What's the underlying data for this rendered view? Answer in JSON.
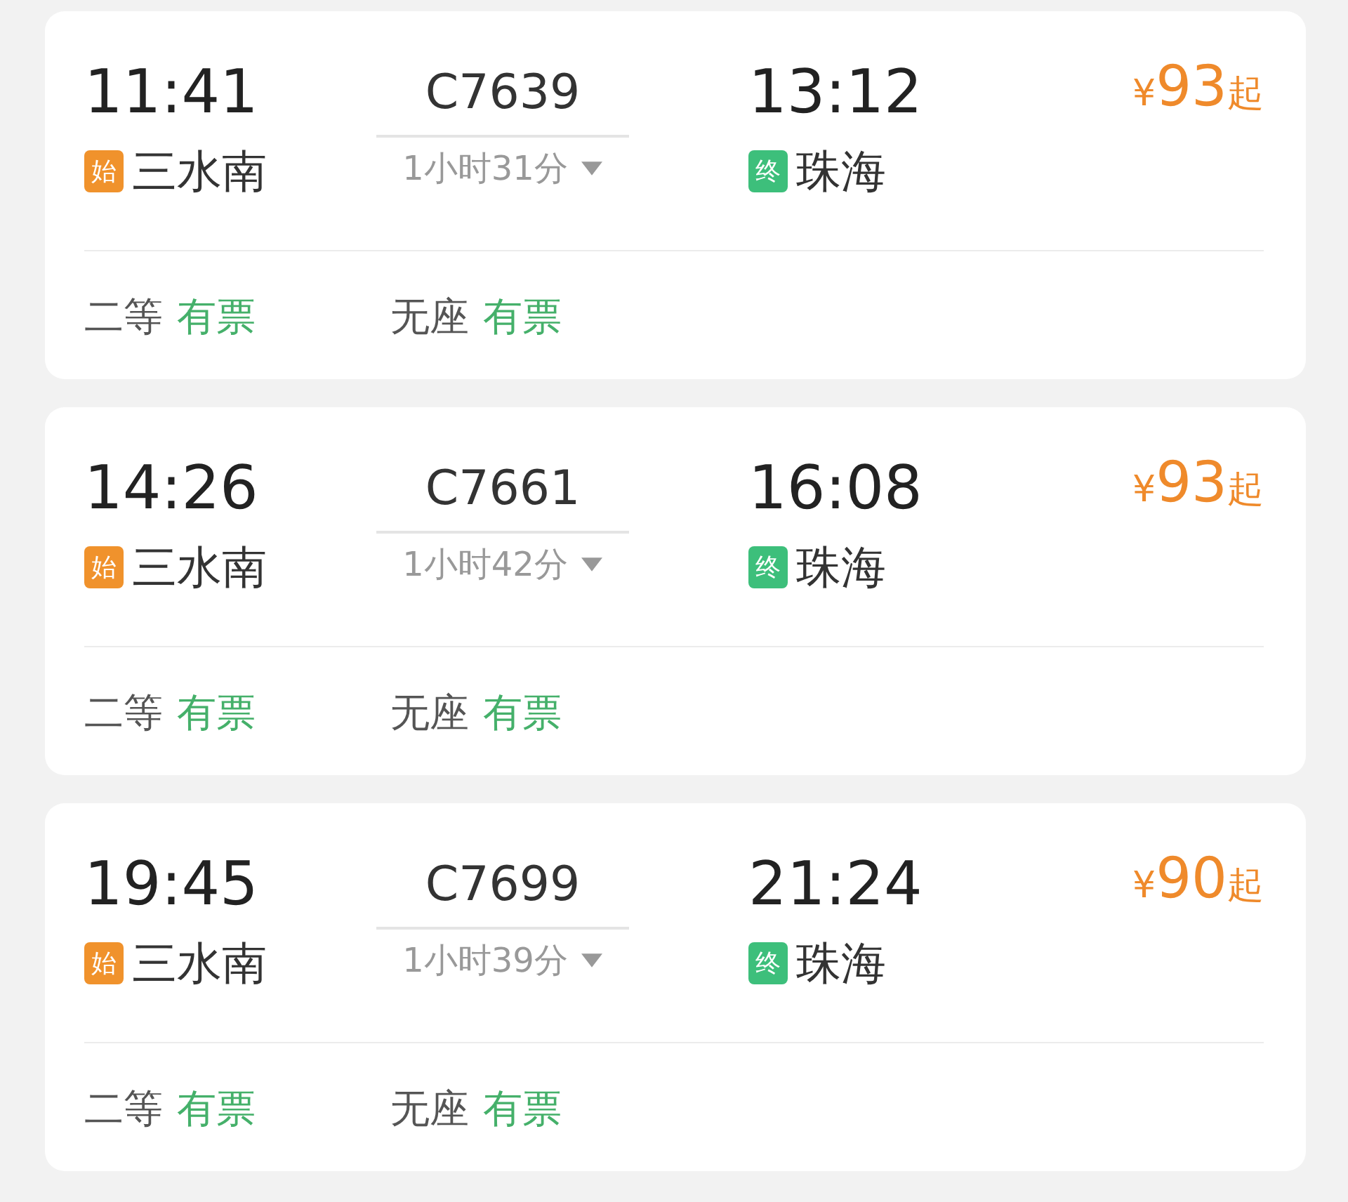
{
  "trains": [
    {
      "depart_time": "11:41",
      "depart_badge": {
        "kind": "start",
        "text": "始"
      },
      "depart_station": "三水南",
      "train_no": "C7639",
      "duration": "1小时31分",
      "arrive_time": "13:12",
      "arrive_badge": {
        "kind": "end",
        "text": "终"
      },
      "arrive_station": "珠海",
      "price": {
        "currency": "¥",
        "amount": "93",
        "suffix": "起"
      },
      "seats": [
        {
          "class": "二等",
          "status": "有票"
        },
        {
          "class": "无座",
          "status": "有票"
        }
      ]
    },
    {
      "depart_time": "14:26",
      "depart_badge": {
        "kind": "start",
        "text": "始"
      },
      "depart_station": "三水南",
      "train_no": "C7661",
      "duration": "1小时42分",
      "arrive_time": "16:08",
      "arrive_badge": {
        "kind": "end",
        "text": "终"
      },
      "arrive_station": "珠海",
      "price": {
        "currency": "¥",
        "amount": "93",
        "suffix": "起"
      },
      "seats": [
        {
          "class": "二等",
          "status": "有票"
        },
        {
          "class": "无座",
          "status": "有票"
        }
      ]
    },
    {
      "depart_time": "19:45",
      "depart_badge": {
        "kind": "start",
        "text": "始"
      },
      "depart_station": "三水南",
      "train_no": "C7699",
      "duration": "1小时39分",
      "arrive_time": "21:24",
      "arrive_badge": {
        "kind": "end",
        "text": "终"
      },
      "arrive_station": "珠海",
      "price": {
        "currency": "¥",
        "amount": "90",
        "suffix": "起"
      },
      "seats": [
        {
          "class": "二等",
          "status": "有票"
        },
        {
          "class": "无座",
          "status": "有票"
        }
      ]
    }
  ]
}
